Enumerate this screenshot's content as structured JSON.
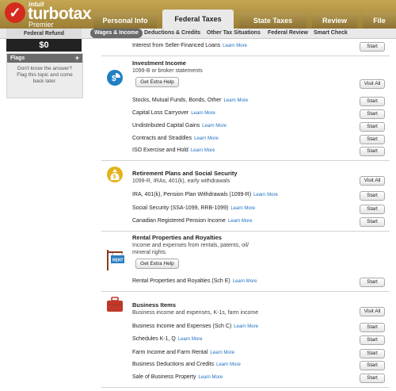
{
  "header": {
    "logo_company": "intuit",
    "logo_product": "turbotax",
    "logo_edition": "Premier",
    "tabs": [
      "Personal Info",
      "Federal Taxes",
      "State Taxes",
      "Review",
      "File"
    ]
  },
  "subnav": [
    "Wages & Income",
    "Deductions & Credits",
    "Other Tax Situations",
    "Federal Review",
    "Smart Check"
  ],
  "sidebar": {
    "refund_label": "Federal Refund",
    "refund_value": "$0",
    "flags_title": "Flags",
    "flags_add": "+",
    "flags_text": "Don't know the answer? Flag this topic and come back later."
  },
  "common": {
    "start": "Start",
    "visit_all": "Visit All",
    "learn_more": "Learn More",
    "get_help": "Get Extra Help"
  },
  "top_item": "Interest from Seller-Financed Loans",
  "sections": {
    "investment": {
      "title": "Investment Income",
      "desc": "1099-B or broker statements",
      "items": [
        "Stocks, Mutual Funds, Bonds, Other",
        "Capital Loss Carryover",
        "Undistributed Capital Gains",
        "Contracts and Straddles",
        "ISO Exercise and Hold"
      ]
    },
    "retirement": {
      "title": "Retirement Plans and Social Security",
      "desc": "1099-R, IRAs, 401(k), early withdrawals",
      "items": [
        "IRA, 401(k), Pension Plan Withdrawals (1099-R)",
        "Social Security (SSA-1099, RRB-1099)",
        "Canadian Registered Pension Income"
      ]
    },
    "rental": {
      "title": "Rental Properties and Royalties",
      "desc_line1": "Income and expenses from rentals, patents, oil/",
      "desc_line2": "mineral rights",
      "sign_text": "RENT",
      "items": [
        "Rental Properties and Royalties (Sch E)"
      ]
    },
    "business": {
      "title": "Business Items",
      "desc": "Business income and expenses, K-1s, farm income",
      "items": [
        "Business Income and Expenses (Sch C)",
        "Schedules K-1, Q",
        "Farm Income and Farm Rental",
        "Business Deductions and Credits",
        "Sale of Business Property"
      ]
    }
  },
  "colors": {
    "header_gold": "#b89a47",
    "turbotax_red": "#d52b1e",
    "link_blue": "#1c6ec1",
    "investment_icon": "#1f7fc3",
    "retirement_icon": "#e4b21a",
    "business_icon": "#c0392b"
  }
}
